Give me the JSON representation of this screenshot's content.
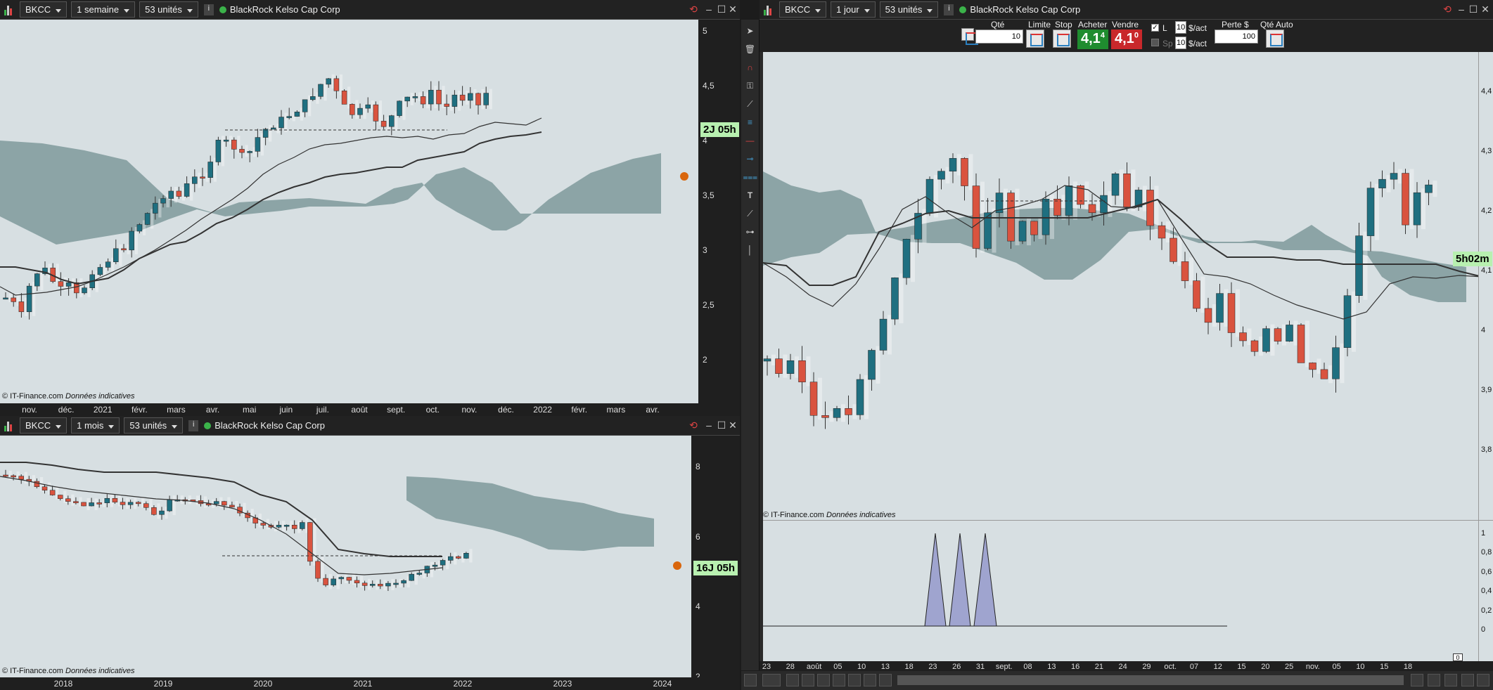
{
  "panel_top_left": {
    "symbol": "BKCC",
    "timeframe": "1 semaine",
    "units": "53 unités",
    "name": "BlackRock Kelso Cap Corp",
    "countdown": "2J 05h",
    "credit": "© IT-Finance.com",
    "credit_note": "Données indicatives",
    "x_ticks": [
      "nov.",
      "déc.",
      "2021",
      "févr.",
      "mars",
      "avr.",
      "mai",
      "juin",
      "juil.",
      "août",
      "sept.",
      "oct.",
      "nov.",
      "déc.",
      "2022",
      "févr.",
      "mars",
      "avr."
    ],
    "y_ticks": [
      "5",
      "4,5",
      "4",
      "3,5",
      "3",
      "2,5",
      "2"
    ]
  },
  "panel_bottom_left": {
    "symbol": "BKCC",
    "timeframe": "1 mois",
    "units": "53 unités",
    "name": "BlackRock Kelso Cap Corp",
    "countdown": "16J 05h",
    "credit": "© IT-Finance.com",
    "credit_note": "Données indicatives",
    "x_ticks": [
      "2018",
      "2019",
      "2020",
      "2021",
      "2022",
      "2023",
      "2024"
    ],
    "y_ticks": [
      "8",
      "6",
      "4",
      "2"
    ]
  },
  "panel_right": {
    "symbol": "BKCC",
    "timeframe": "1 jour",
    "units": "53 unités",
    "name": "BlackRock Kelso Cap Corp",
    "countdown": "5h02m",
    "credit": "© IT-Finance.com",
    "credit_note": "Données indicatives",
    "x_ticks": [
      "23",
      "28",
      "août",
      "05",
      "10",
      "13",
      "18",
      "23",
      "26",
      "31",
      "sept.",
      "08",
      "13",
      "16",
      "21",
      "24",
      "29",
      "oct.",
      "07",
      "12",
      "15",
      "20",
      "25",
      "nov.",
      "05",
      "10",
      "15",
      "18"
    ],
    "y_ticks": [
      "4,4",
      "4,3",
      "4,2",
      "4,1",
      "4",
      "3,9",
      "3,8"
    ],
    "indicator_y_ticks": [
      "1",
      "0,8",
      "0,6",
      "0,4",
      "0,2",
      "0"
    ],
    "order": {
      "qty_label": "Qté",
      "qty_value": "10",
      "limit_label": "Limite",
      "stop_label": "Stop",
      "buy_label": "Acheter",
      "sell_label": "Vendre",
      "buy_price": "4,1",
      "buy_price_sup": "4",
      "sell_price": "4,1",
      "sell_price_sup": "0",
      "l_label": "L",
      "l_value": "10",
      "l_unit": "$/act",
      "sp_label": "Sp",
      "sp_value": "10",
      "sp_unit": "$/act",
      "loss_label": "Perte $",
      "loss_value": "100",
      "auto_qty_label": "Qté Auto"
    }
  },
  "colors": {
    "bull": "#1f6f80",
    "bear": "#d9533f",
    "cloud": "#7f9a9b",
    "background": "#d7dfe2",
    "accent_timer": "#b8f0b0"
  }
}
